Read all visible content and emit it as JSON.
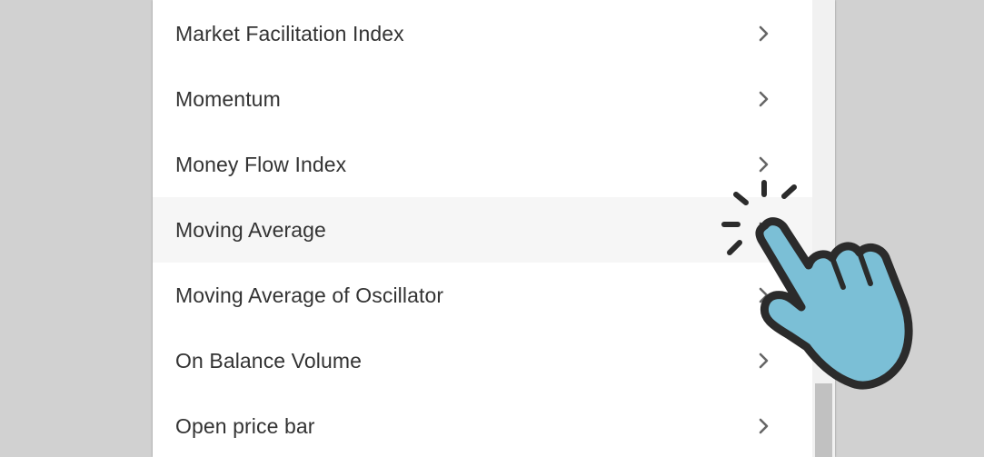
{
  "menu": {
    "items": [
      {
        "label": "Market Facilitation Index",
        "chevron_icon": "chevron-right-icon"
      },
      {
        "label": "Momentum",
        "chevron_icon": "chevron-right-icon"
      },
      {
        "label": "Money Flow Index",
        "chevron_icon": "chevron-right-icon"
      },
      {
        "label": "Moving Average",
        "chevron_icon": "chevron-right-icon",
        "state": "hovered"
      },
      {
        "label": "Moving Average of Oscillator",
        "chevron_icon": "chevron-right-icon"
      },
      {
        "label": "On Balance Volume",
        "chevron_icon": "chevron-right-icon"
      },
      {
        "label": "Open price bar",
        "chevron_icon": "chevron-right-icon"
      }
    ]
  },
  "overlay": {
    "icon": "pointing-hand-click-icon"
  },
  "colors": {
    "background": "#d1d1d1",
    "panel": "#ffffff",
    "hover_row": "#f6f6f6",
    "text": "#333333",
    "chevron": "#666666",
    "scroll_track": "#f1f1f1",
    "scroll_thumb": "#c1c1c1",
    "hand_fill": "#7bbfd6",
    "hand_outline": "#2b2b2b"
  }
}
